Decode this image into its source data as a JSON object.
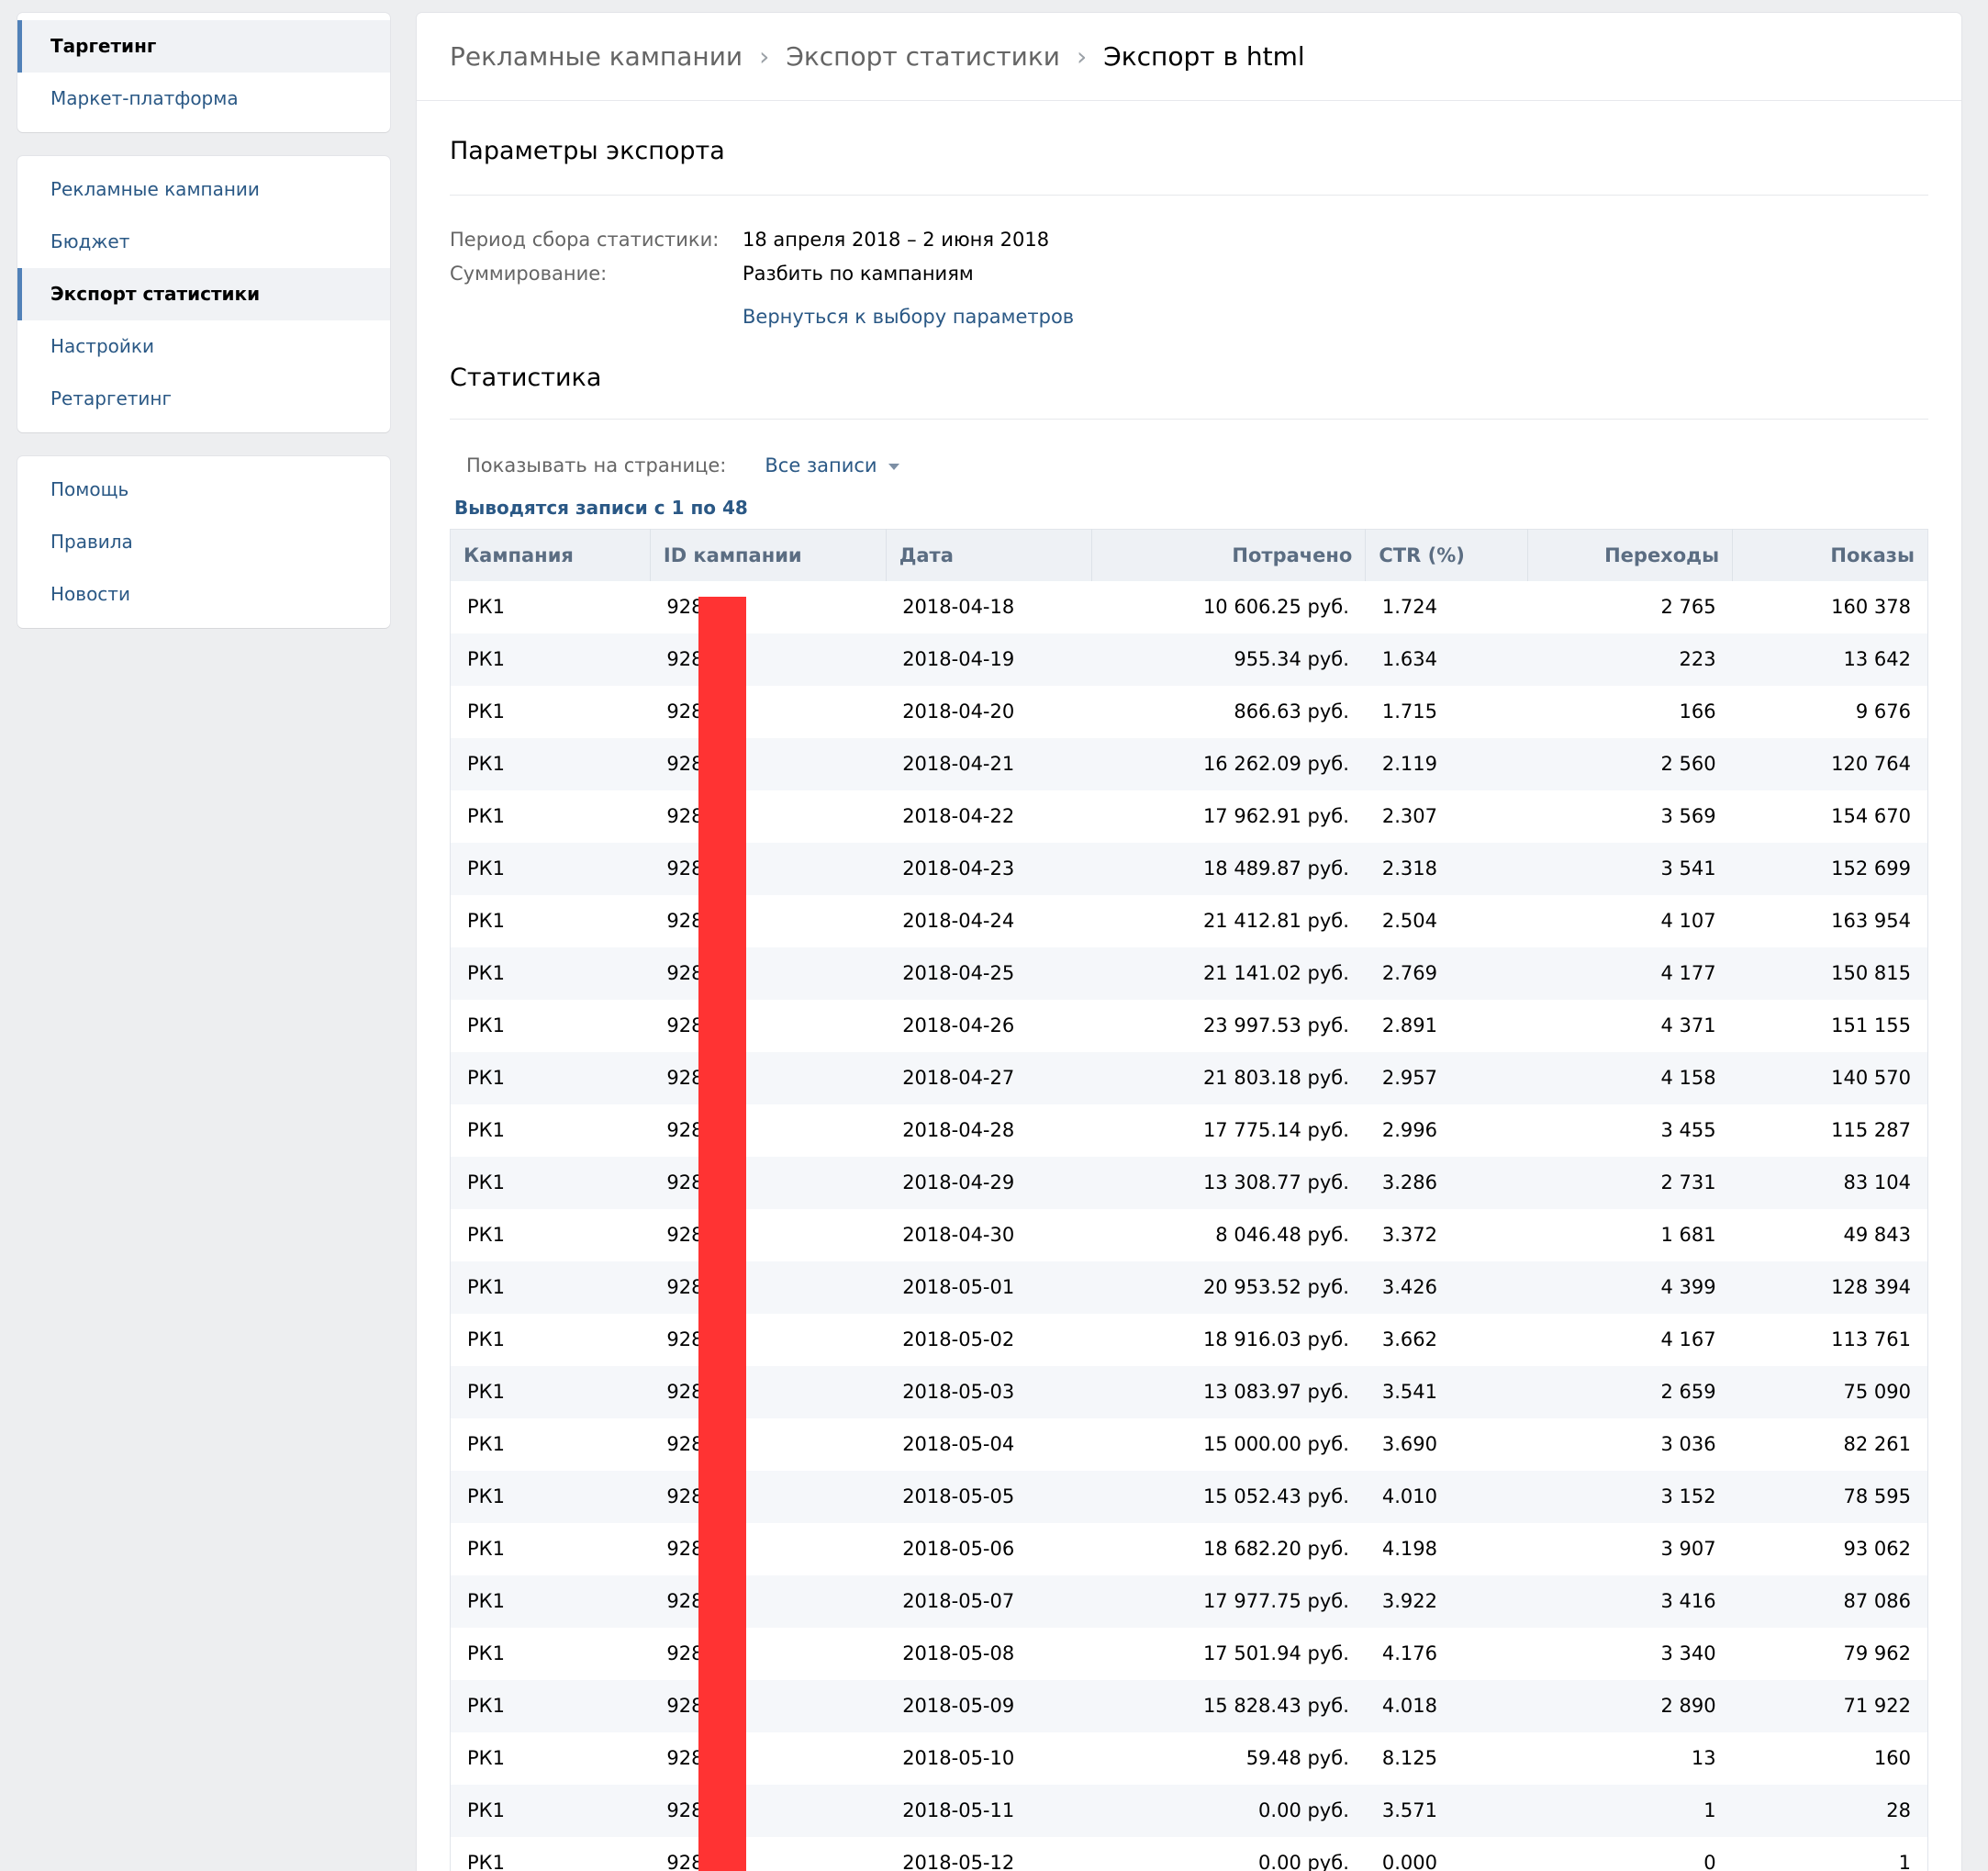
{
  "sidebar": {
    "group1": [
      {
        "label": "Таргетинг",
        "active": true
      },
      {
        "label": "Маркет-платформа",
        "active": false
      }
    ],
    "group2": [
      {
        "label": "Рекламные кампании",
        "active": false
      },
      {
        "label": "Бюджет",
        "active": false
      },
      {
        "label": "Экспорт статистики",
        "active": true
      },
      {
        "label": "Настройки",
        "active": false
      },
      {
        "label": "Ретаргетинг",
        "active": false
      }
    ],
    "group3": [
      {
        "label": "Помощь",
        "active": false
      },
      {
        "label": "Правила",
        "active": false
      },
      {
        "label": "Новости",
        "active": false
      }
    ]
  },
  "breadcrumbs": [
    "Рекламные кампании",
    "Экспорт статистики",
    "Экспорт в html"
  ],
  "params": {
    "title": "Параметры экспорта",
    "period_label": "Период сбора статистики:",
    "period_value": "18 апреля 2018 – 2 июня 2018",
    "sum_label": "Суммирование:",
    "sum_value": "Разбить по кампаниям",
    "back_link": "Вернуться к выбору параметров"
  },
  "stats": {
    "title": "Статистика",
    "per_page_label": "Показывать на странице:",
    "per_page_value": "Все записи",
    "records_info": "Выводятся записи с 1 по 48",
    "columns": [
      "Кампания",
      "ID кампании",
      "Дата",
      "Потрачено",
      "CTR (%)",
      "Переходы",
      "Показы"
    ],
    "rows": [
      [
        "РК1",
        "928",
        "2018-04-18",
        "10 606.25 руб.",
        "1.724",
        "2 765",
        "160 378"
      ],
      [
        "РК1",
        "928",
        "2018-04-19",
        "955.34 руб.",
        "1.634",
        "223",
        "13 642"
      ],
      [
        "РК1",
        "928",
        "2018-04-20",
        "866.63 руб.",
        "1.715",
        "166",
        "9 676"
      ],
      [
        "РК1",
        "928",
        "2018-04-21",
        "16 262.09 руб.",
        "2.119",
        "2 560",
        "120 764"
      ],
      [
        "РК1",
        "928",
        "2018-04-22",
        "17 962.91 руб.",
        "2.307",
        "3 569",
        "154 670"
      ],
      [
        "РК1",
        "928",
        "2018-04-23",
        "18 489.87 руб.",
        "2.318",
        "3 541",
        "152 699"
      ],
      [
        "РК1",
        "928",
        "2018-04-24",
        "21 412.81 руб.",
        "2.504",
        "4 107",
        "163 954"
      ],
      [
        "РК1",
        "928",
        "2018-04-25",
        "21 141.02 руб.",
        "2.769",
        "4 177",
        "150 815"
      ],
      [
        "РК1",
        "928",
        "2018-04-26",
        "23 997.53 руб.",
        "2.891",
        "4 371",
        "151 155"
      ],
      [
        "РК1",
        "928",
        "2018-04-27",
        "21 803.18 руб.",
        "2.957",
        "4 158",
        "140 570"
      ],
      [
        "РК1",
        "928",
        "2018-04-28",
        "17 775.14 руб.",
        "2.996",
        "3 455",
        "115 287"
      ],
      [
        "РК1",
        "928",
        "2018-04-29",
        "13 308.77 руб.",
        "3.286",
        "2 731",
        "83 104"
      ],
      [
        "РК1",
        "928",
        "2018-04-30",
        "8 046.48 руб.",
        "3.372",
        "1 681",
        "49 843"
      ],
      [
        "РК1",
        "928",
        "2018-05-01",
        "20 953.52 руб.",
        "3.426",
        "4 399",
        "128 394"
      ],
      [
        "РК1",
        "928",
        "2018-05-02",
        "18 916.03 руб.",
        "3.662",
        "4 167",
        "113 761"
      ],
      [
        "РК1",
        "928",
        "2018-05-03",
        "13 083.97 руб.",
        "3.541",
        "2 659",
        "75 090"
      ],
      [
        "РК1",
        "928",
        "2018-05-04",
        "15 000.00 руб.",
        "3.690",
        "3 036",
        "82 261"
      ],
      [
        "РК1",
        "928",
        "2018-05-05",
        "15 052.43 руб.",
        "4.010",
        "3 152",
        "78 595"
      ],
      [
        "РК1",
        "928",
        "2018-05-06",
        "18 682.20 руб.",
        "4.198",
        "3 907",
        "93 062"
      ],
      [
        "РК1",
        "928",
        "2018-05-07",
        "17 977.75 руб.",
        "3.922",
        "3 416",
        "87 086"
      ],
      [
        "РК1",
        "928",
        "2018-05-08",
        "17 501.94 руб.",
        "4.176",
        "3 340",
        "79 962"
      ],
      [
        "РК1",
        "928",
        "2018-05-09",
        "15 828.43 руб.",
        "4.018",
        "2 890",
        "71 922"
      ],
      [
        "РК1",
        "928",
        "2018-05-10",
        "59.48 руб.",
        "8.125",
        "13",
        "160"
      ],
      [
        "РК1",
        "928",
        "2018-05-11",
        "0.00 руб.",
        "3.571",
        "1",
        "28"
      ],
      [
        "РК1",
        "928",
        "2018-05-12",
        "0.00 руб.",
        "0.000",
        "0",
        "1"
      ]
    ]
  },
  "colors": {
    "link": "#2a5885",
    "accent": "#5181b8",
    "redaction": "#ff3333"
  }
}
